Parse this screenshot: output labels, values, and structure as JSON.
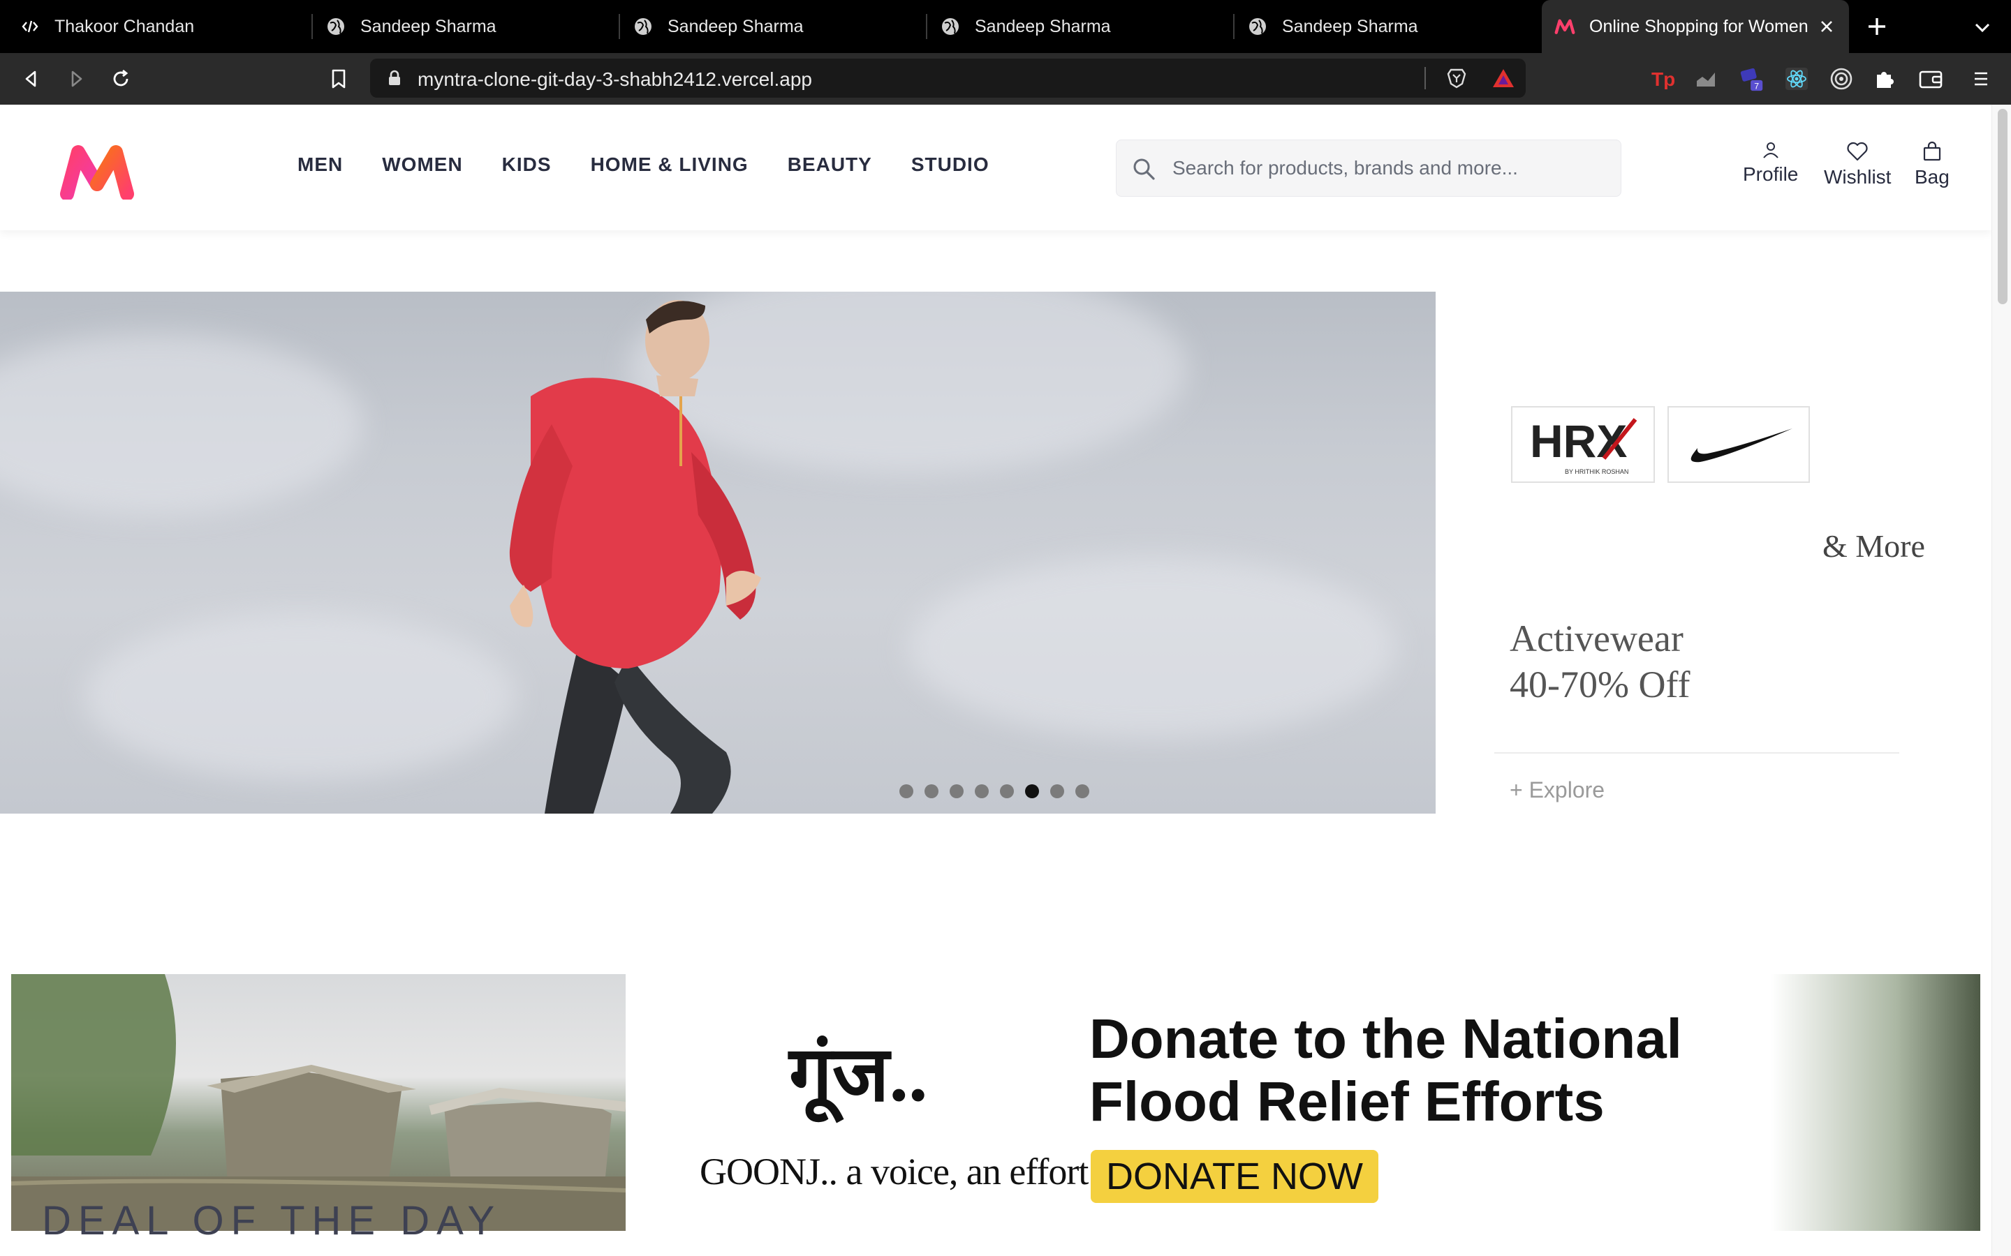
{
  "browser": {
    "tabs": [
      {
        "title": "Thakoor Chandan",
        "icon": "code-icon"
      },
      {
        "title": "Sandeep Sharma",
        "icon": "globe-icon"
      },
      {
        "title": "Sandeep Sharma",
        "icon": "globe-icon"
      },
      {
        "title": "Sandeep Sharma",
        "icon": "globe-icon"
      },
      {
        "title": "Sandeep Sharma",
        "icon": "globe-icon"
      },
      {
        "title": "Online Shopping for Women",
        "icon": "myntra-favicon",
        "active": true
      }
    ],
    "url": "myntra-clone-git-day-3-shabh2412.vercel.app",
    "extension_badge": "7"
  },
  "header": {
    "nav": [
      "MEN",
      "WOMEN",
      "KIDS",
      "HOME & LIVING",
      "BEAUTY",
      "STUDIO"
    ],
    "search_placeholder": "Search for products, brands and more...",
    "profile_label": "Profile",
    "wishlist_label": "Wishlist",
    "bag_label": "Bag"
  },
  "hero": {
    "brand_hrx": "HRX",
    "brand_hrx_sub": "BY HRITHIK ROSHAN",
    "and_more": "& More",
    "title_line1": "Activewear",
    "title_line2": "40-70% Off",
    "explore": "+ Explore",
    "dots_total": 8,
    "dots_active_index": 5
  },
  "donate_banner": {
    "hindi_logo": "गूंज..",
    "tagline": "GOONJ.. a voice, an effort",
    "headline_line1": "Donate to the National",
    "headline_line2": "Flood Relief Efforts",
    "button": "DONATE NOW"
  },
  "section_title": "DEAL OF THE DAY",
  "colors": {
    "brand_pink": "#ff3f6c",
    "brand_orange": "#f97316",
    "text_dark": "#282c3f",
    "donate_yellow": "#f4d03f"
  }
}
